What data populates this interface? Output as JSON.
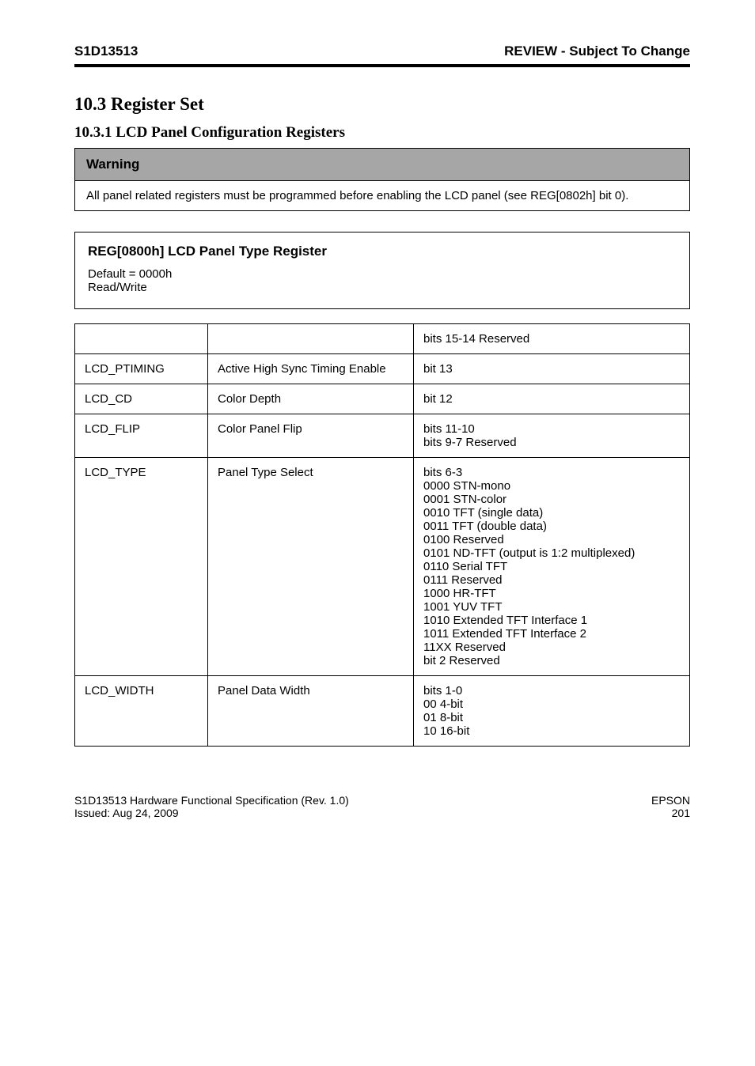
{
  "header": {
    "left": "S1D13513",
    "right": "REVIEW - Subject To Change"
  },
  "section_title": "10.3  Register Set",
  "subsection_title": "10.3.1  LCD Panel Configuration Registers",
  "warning": {
    "title": "Warning",
    "body": "All panel related registers must be programmed before enabling the LCD panel (see REG[0802h] bit 0)."
  },
  "framed": {
    "title": "REG[0800h] LCD Panel Type Register",
    "row1": "Default = 0000h",
    "row2": "Read/Write"
  },
  "table": {
    "rows": [
      {
        "c0": "",
        "c1": "",
        "c2": "bits 15-14  Reserved"
      },
      {
        "c0": "LCD_PTIMING",
        "c1": "Active High Sync Timing Enable",
        "c2": "bit 13"
      },
      {
        "c0": "LCD_CD",
        "c1": "Color Depth",
        "c2": "bit 12"
      },
      {
        "c0": "LCD_FLIP",
        "c1": "Color Panel Flip",
        "c2": "bits 11-10\nbits 9-7  Reserved"
      },
      {
        "c0": "LCD_TYPE",
        "c1": "Panel Type Select",
        "c2": "bits 6-3\n0000  STN-mono\n0001  STN-color\n0010  TFT (single data)\n0011  TFT (double data)\n0100  Reserved\n0101  ND-TFT (output is 1:2 multiplexed)\n0110  Serial TFT\n0111  Reserved\n1000  HR-TFT\n1001  YUV TFT\n1010  Extended TFT Interface 1\n1011  Extended TFT Interface 2\n11XX  Reserved\nbit 2  Reserved"
      },
      {
        "c0": "LCD_WIDTH",
        "c1": "Panel Data Width",
        "c2": "bits 1-0\n00  4-bit\n01  8-bit\n10  16-bit"
      }
    ]
  },
  "footer": {
    "left_top": "S1D13513 Hardware Functional Specification  (Rev. 1.0)",
    "right_top": "EPSON",
    "left_bottom": "Issued: Aug 24, 2009",
    "right_bottom": "201"
  }
}
